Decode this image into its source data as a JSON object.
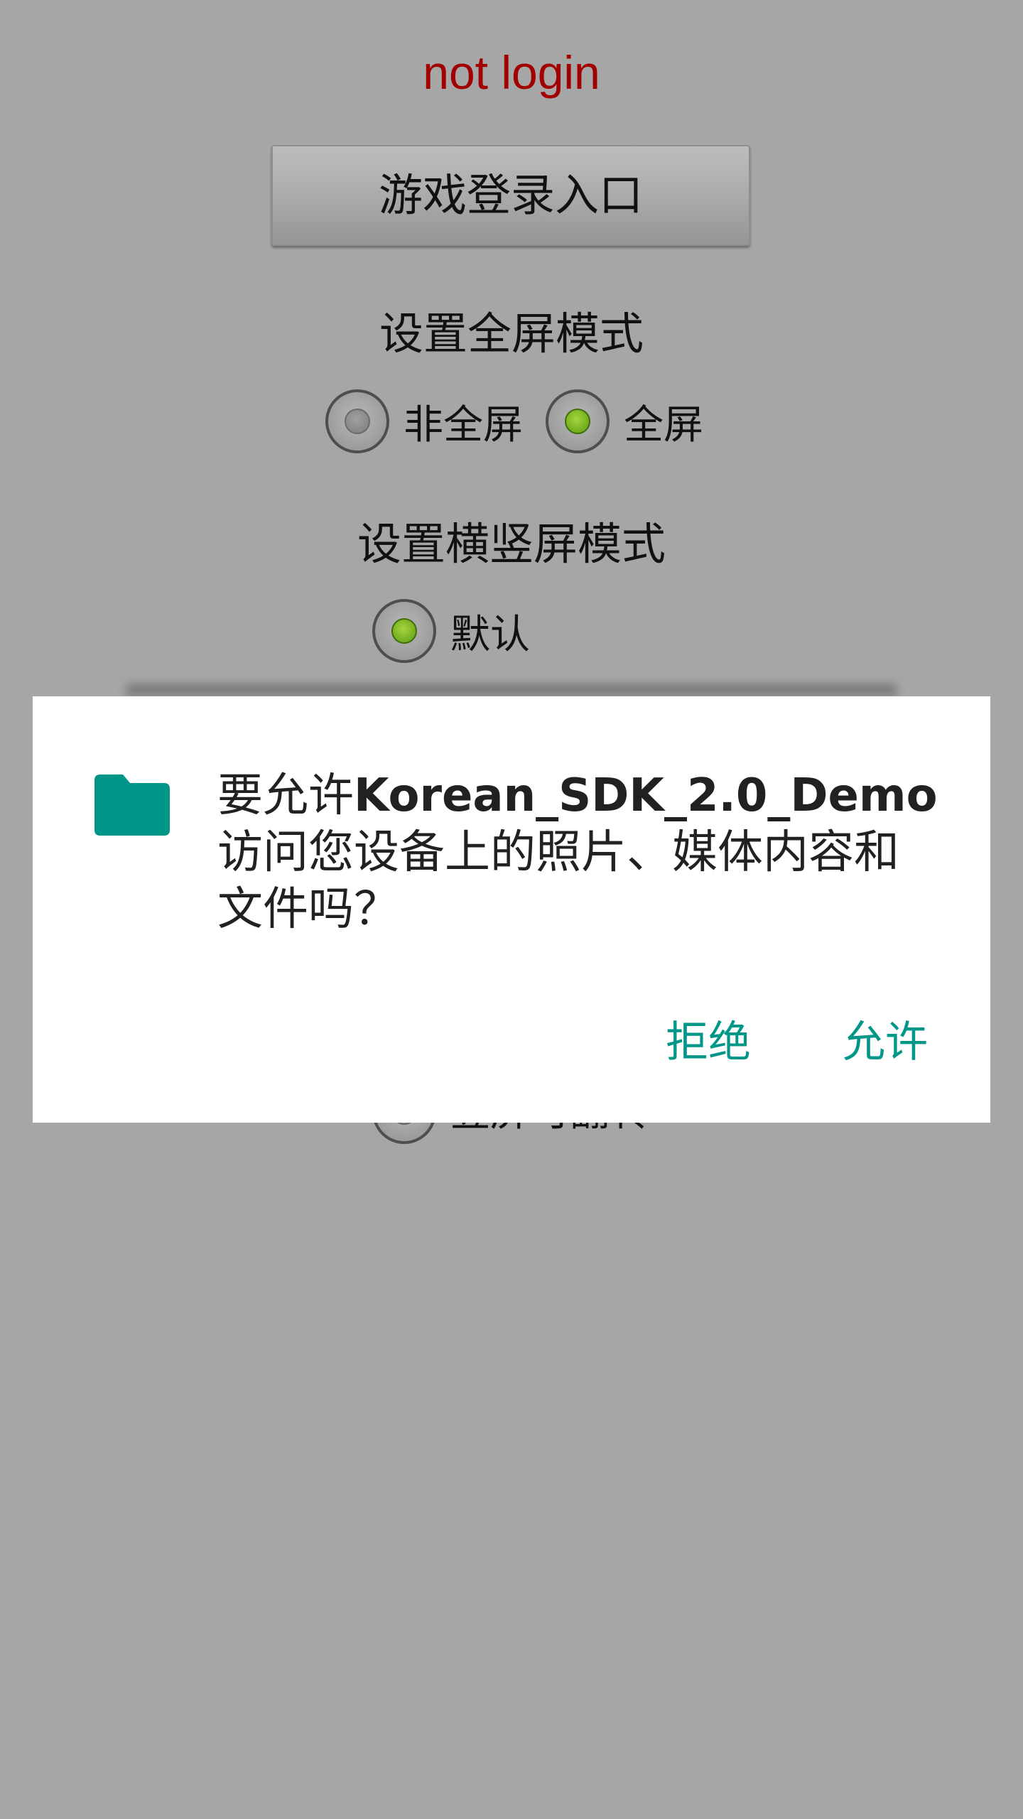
{
  "status": {
    "text": "not login",
    "color": "#a20000"
  },
  "login_button": {
    "label": "游戏登录入口"
  },
  "fullscreen_section": {
    "title": "设置全屏模式",
    "options": [
      {
        "label": "非全屏",
        "selected": false
      },
      {
        "label": "全屏",
        "selected": true
      }
    ]
  },
  "orientation_section": {
    "title": "设置横竖屏模式",
    "options": [
      {
        "label": "默认",
        "selected": true
      },
      {
        "label": "竖屏可翻转",
        "selected": false
      }
    ]
  },
  "dialog": {
    "icon": "folder-icon",
    "icon_color": "#009688",
    "message_prefix": "要允许",
    "app_name": "Korean_SDK_2.0_Demo",
    "message_suffix": "访问您设备上的照片、媒体内容和文件吗？",
    "deny_label": "拒绝",
    "allow_label": "允许",
    "accent_color": "#009688"
  }
}
